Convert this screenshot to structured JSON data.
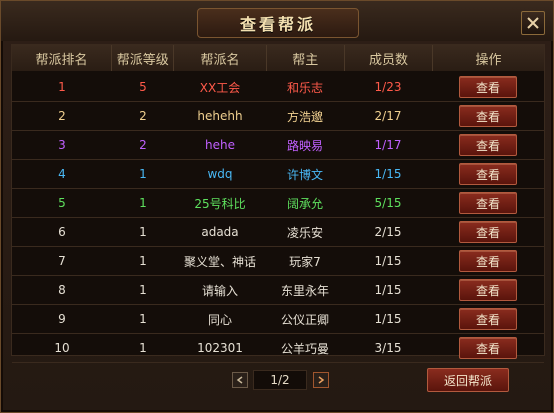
{
  "dialog": {
    "title": "查看帮派",
    "close_icon": "close-icon"
  },
  "table": {
    "headers": [
      "帮派排名",
      "帮派等级",
      "帮派名",
      "帮主",
      "成员数",
      "操作"
    ],
    "rows": [
      {
        "rank": "1",
        "level": "5",
        "name": "XX工会",
        "leader": "和乐志",
        "members": "1/23",
        "color": "#ff5a4a"
      },
      {
        "rank": "2",
        "level": "2",
        "name": "hehehh",
        "leader": "方浩邈",
        "members": "2/17",
        "color": "#f0d090"
      },
      {
        "rank": "3",
        "level": "2",
        "name": "hehe",
        "leader": "路映易",
        "members": "1/17",
        "color": "#c060ff"
      },
      {
        "rank": "4",
        "level": "1",
        "name": "wdq",
        "leader": "许博文",
        "members": "1/15",
        "color": "#49b8f5"
      },
      {
        "rank": "5",
        "level": "1",
        "name": "25号科比",
        "leader": "阔承允",
        "members": "5/15",
        "color": "#5ee05e"
      },
      {
        "rank": "6",
        "level": "1",
        "name": "adada",
        "leader": "凌乐安",
        "members": "2/15",
        "color": "#e6e0d4"
      },
      {
        "rank": "7",
        "level": "1",
        "name": "聚义堂、神话",
        "leader": "玩家7",
        "members": "1/15",
        "color": "#e6e0d4"
      },
      {
        "rank": "8",
        "level": "1",
        "name": "请输入",
        "leader": "东里永年",
        "members": "1/15",
        "color": "#e6e0d4"
      },
      {
        "rank": "9",
        "level": "1",
        "name": "同心",
        "leader": "公仪正卿",
        "members": "1/15",
        "color": "#e6e0d4"
      },
      {
        "rank": "10",
        "level": "1",
        "name": "102301",
        "leader": "公羊巧曼",
        "members": "3/15",
        "color": "#e6e0d4"
      }
    ],
    "action_label": "查看"
  },
  "pager": {
    "label": "1/2",
    "prev_icon": "chevron-left-icon",
    "next_icon": "chevron-right-icon"
  },
  "return_button": "返回帮派"
}
